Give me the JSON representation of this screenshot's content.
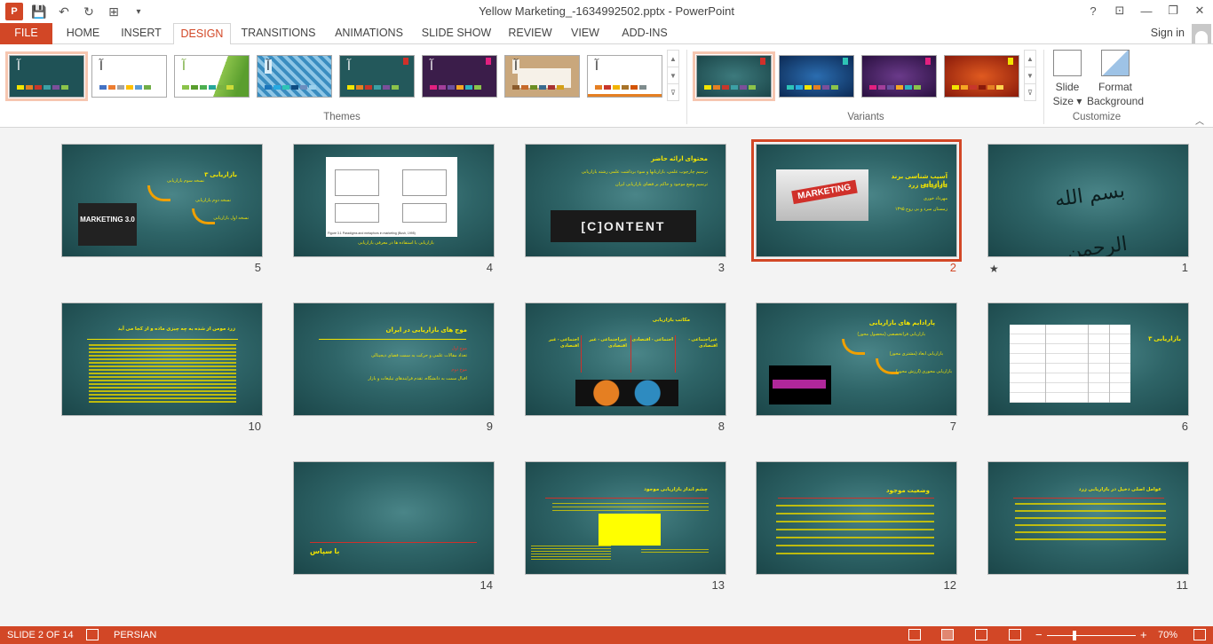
{
  "window": {
    "title": "Yellow Marketing_-1634992502.pptx - PowerPoint",
    "help": "?",
    "controls": [
      "⊡",
      "—",
      "❐",
      "✕"
    ]
  },
  "qat": {
    "app": "P",
    "save": "💾",
    "undo": "↶",
    "redo": "↻",
    "present": "⊞",
    "customize": "▾"
  },
  "tabs": {
    "file": "FILE",
    "items": [
      "HOME",
      "INSERT",
      "DESIGN",
      "TRANSITIONS",
      "ANIMATIONS",
      "SLIDE SHOW",
      "REVIEW",
      "VIEW",
      "ADD-INS"
    ],
    "active": "DESIGN",
    "signin": "Sign in"
  },
  "ribbon": {
    "themes_label": "Themes",
    "variants_label": "Variants",
    "customize_label": "Customize",
    "theme_glyph": "آ",
    "slide_size": "Slide Size",
    "slide_size_line1": "Slide",
    "slide_size_line2": "Size ▾",
    "format_bg_line1": "Format",
    "format_bg_line2": "Background",
    "collapse": "︿",
    "scroll": [
      "▲",
      "▼",
      "⊽"
    ]
  },
  "slides": [
    {
      "num": "1",
      "star": "★",
      "caption": "بسم الله الرحمن الرحیم"
    },
    {
      "num": "2",
      "title": "آسیب شناسی برند بازاریابی",
      "subtitle": "بازاریابی زرد",
      "lines": [
        "مهرداد خوری",
        "زمستان سرد و بی روح ۱۳۹۵"
      ],
      "image_text": "MARKETING"
    },
    {
      "num": "3",
      "title": "محتوای ارائه حاضر",
      "lines": [
        "ترسیم چارچوب علمی، بازاریابها و سوء برداشت علمی رشته بازاریابی",
        "ترسیم وضع موجود و حاکم بر فضای بازاریابی ایران"
      ],
      "image_text": "[C]ONTENT"
    },
    {
      "num": "4",
      "caption": "بازاریابی با استفاده ها در معرفی بازاریابی",
      "figure_caption": "Figure 3.1   Paradigms and metaphors in marketing (Bush, 1995)"
    },
    {
      "num": "5",
      "title": "بازاریابی ۳",
      "lines": [
        "نسخه سوم بازاریابی",
        "نسخه دوم بازاریابی",
        "نسخه اول بازاریابی"
      ],
      "image_text": "MARKETING 3.0"
    },
    {
      "num": "6",
      "title": "بازاریابی ۳"
    },
    {
      "num": "7",
      "title": "پارادایم های بازاریابی",
      "lines": [
        "بازاریابی فراتخصصی (محصول محور)",
        "بازاریابی ابعاد (مشتری محور)",
        "بازاریابی محوری (ارزش محور)"
      ]
    },
    {
      "num": "8",
      "title": "مکاتب بازاریابی",
      "cols": [
        "غیراجتماعی - اقتصادی",
        "اجتماعی - اقتصادی",
        "غیراجتماعی - غیر اقتصادی",
        "اجتماعی - غیر اقتصادی"
      ]
    },
    {
      "num": "9",
      "title": "موج های بازاریابی در ایران",
      "red1": "موج اول",
      "line1": "تعداد مقالات علمی و حرکت به سمت فضای دیجیتالی",
      "red2": "موج دوم",
      "line2": "اقبال سمت به دانشگاه، تقدم فرایندهای تبلیغات و بازار"
    },
    {
      "num": "10",
      "title": "زرد مومن از شده به چه چیزی ماده و از کجا می آید"
    },
    {
      "num": "11",
      "title": "عوامل اصلی دخیل در بازاریابی زرد"
    },
    {
      "num": "12",
      "title": "وضعیت موجود"
    },
    {
      "num": "13",
      "title": "چشم انداز بازاریابی موجود"
    },
    {
      "num": "14",
      "title": "با سپاس"
    }
  ],
  "status": {
    "slide_indicator": "SLIDE 2 OF 14",
    "language": "PERSIAN",
    "zoom": "70%",
    "zoom_out": "−",
    "zoom_in": "+"
  },
  "colors": {
    "accent": "#d24726",
    "slide_text": "#f2e400",
    "slide_bg": "#2e6467"
  }
}
